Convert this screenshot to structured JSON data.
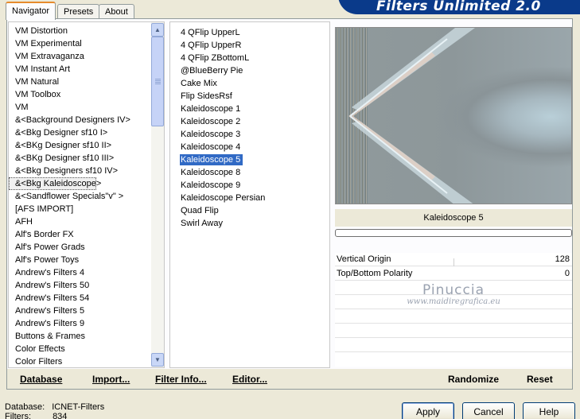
{
  "tabs": [
    {
      "label": "Navigator"
    },
    {
      "label": "Presets"
    },
    {
      "label": "About"
    }
  ],
  "brand": {
    "title": "Filters Unlimited 2.0"
  },
  "categories": [
    {
      "label": "VM Distortion"
    },
    {
      "label": "VM Experimental"
    },
    {
      "label": "VM Extravaganza"
    },
    {
      "label": "VM Instant Art"
    },
    {
      "label": "VM Natural"
    },
    {
      "label": "VM Toolbox"
    },
    {
      "label": "VM"
    },
    {
      "label": "&<Background Designers IV>"
    },
    {
      "label": "&<Bkg Designer sf10 I>"
    },
    {
      "label": "&<BKg Designer sf10 II>"
    },
    {
      "label": "&<BKg Designer sf10 III>"
    },
    {
      "label": "&<Bkg Designers sf10 IV>"
    },
    {
      "label": "&<Bkg Kaleidoscope>"
    },
    {
      "label": "&<Sandflower Specials\"v\" >"
    },
    {
      "label": "[AFS IMPORT]"
    },
    {
      "label": "AFH"
    },
    {
      "label": "Alf's Border FX"
    },
    {
      "label": "Alf's Power Grads"
    },
    {
      "label": "Alf's Power Toys"
    },
    {
      "label": "Andrew's Filters 4"
    },
    {
      "label": "Andrew's Filters 50"
    },
    {
      "label": "Andrew's Filters 54"
    },
    {
      "label": "Andrew's Filters 5"
    },
    {
      "label": "Andrew's Filters 9"
    },
    {
      "label": "Buttons & Frames"
    },
    {
      "label": "Color Effects"
    },
    {
      "label": "Color Filters"
    }
  ],
  "filters": [
    {
      "label": "4 QFlip UpperL"
    },
    {
      "label": "4 QFlip UpperR"
    },
    {
      "label": "4 QFlip ZBottomL"
    },
    {
      "label": "@BlueBerry Pie"
    },
    {
      "label": "Cake Mix"
    },
    {
      "label": "Flip SidesRsf"
    },
    {
      "label": "Kaleidoscope 1"
    },
    {
      "label": "Kaleidoscope 2"
    },
    {
      "label": "Kaleidoscope 3"
    },
    {
      "label": "Kaleidoscope 4"
    },
    {
      "label": "Kaleidoscope 5"
    },
    {
      "label": "Kaleidoscope 8"
    },
    {
      "label": "Kaleidoscope 9"
    },
    {
      "label": "Kaleidoscope Persian"
    },
    {
      "label": "Quad Flip"
    },
    {
      "label": "Swirl Away"
    }
  ],
  "selected_filter": "Kaleidoscope 5",
  "controls": [
    {
      "label": "Vertical Origin",
      "value": "128"
    },
    {
      "label": "Top/Bottom Polarity",
      "value": "0"
    }
  ],
  "watermark": {
    "line1": "Pinuccia",
    "line2": "www.maidiregrafica.eu"
  },
  "buttons": {
    "database": "Database",
    "import": "Import...",
    "filter_info": "Filter Info...",
    "editor": "Editor...",
    "randomize": "Randomize",
    "reset": "Reset",
    "apply": "Apply",
    "cancel": "Cancel",
    "help": "Help"
  },
  "status": {
    "database_label": "Database:",
    "database_value": "ICNET-Filters",
    "filters_label": "Filters:",
    "filters_value": "834"
  },
  "colors": {
    "selection": "#316ac5",
    "tab_accent": "#e68b2c",
    "brand": "#0a3a8a"
  }
}
